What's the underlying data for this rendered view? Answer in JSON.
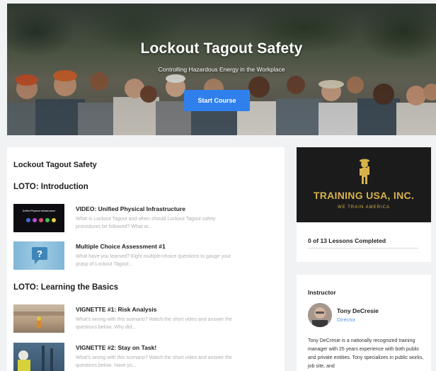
{
  "hero": {
    "title": "Lockout Tagout Safety",
    "subtitle": "Controlling Hazardous Energy in the Workplace",
    "start_button": "Start Course"
  },
  "main": {
    "course_title": "Lockout Tagout Safety",
    "sections": [
      {
        "title": "LOTO: Introduction",
        "lessons": [
          {
            "title": "VIDEO: Unified Physical Infrastructure",
            "description": "What is Lockout Tagout and when should Lockout Tagout safety procedures be followed? What ar...",
            "thumbnail_caption": "Unified Physical Infrastructure"
          },
          {
            "title": "Multiple Choice Assessment #1",
            "description": "What have you learned? Eight multiple-choice questions to gauge your grasp of Lockout Tagout..."
          }
        ]
      },
      {
        "title": "LOTO: Learning the Basics",
        "lessons": [
          {
            "title": "VIGNETTE #1: Risk Analysis",
            "description": "What's wrong with this scenario? Watch the short video and answer the questions below: Why did..."
          },
          {
            "title": "VIGNETTE #2: Stay on Task!",
            "description": "What's wrong with this scenario? Watch the short video and answer the questions below: Have yo..."
          }
        ]
      }
    ]
  },
  "sidebar": {
    "logo": {
      "name": "TRAINING USA, INC.",
      "tagline": "WE TRAIN AMERICA"
    },
    "progress": {
      "text": "0 of 13 Lessons Completed",
      "completed": 0,
      "total": 13
    },
    "instructor": {
      "heading": "Instructor",
      "name": "Tony DeCresie",
      "role": "Director",
      "bio": "Tony DeCresie is a nationally recognized training manager with 25 years experience with both public and private entities. Tony specializes in public works, job site, and"
    }
  },
  "colors": {
    "accent": "#2f80ed",
    "logo_gold": "#d8b14a",
    "page_bg": "#f1f2f4"
  }
}
